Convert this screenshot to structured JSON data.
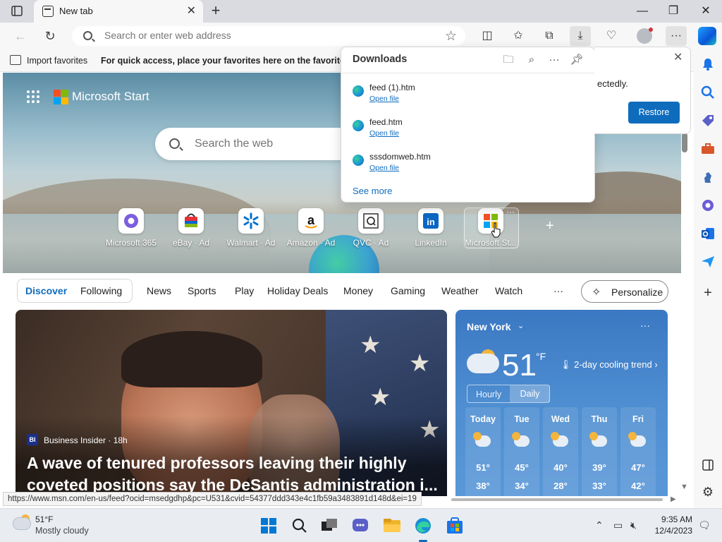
{
  "browser": {
    "tab": {
      "title": "New tab"
    },
    "address": {
      "placeholder": "Search or enter web address"
    },
    "favorites_bar": {
      "import_label": "Import favorites",
      "hint": "For quick access, place your favorites here on the favorites bar."
    },
    "status_url": "https://www.msn.com/en-us/feed?ocid=msedgdhp&pc=U531&cvid=54377ddd343e4c1fb59a3483891d148d&ei=19"
  },
  "downloads": {
    "title": "Downloads",
    "items": [
      {
        "name": "feed (1).htm",
        "action": "Open file"
      },
      {
        "name": "feed.htm",
        "action": "Open file"
      },
      {
        "name": "sssdomweb.htm",
        "action": "Open file"
      }
    ],
    "see_more": "See more"
  },
  "restore_notice": {
    "text_visible": "ectedly.",
    "button": "Restore"
  },
  "new_tab_page": {
    "brand": "Microsoft Start",
    "search_placeholder": "Search the web",
    "tiles": [
      {
        "label": "Microsoft 365",
        "icon": "microsoft-365-icon"
      },
      {
        "label": "eBay · Ad",
        "icon": "ebay-icon"
      },
      {
        "label": "Walmart · Ad",
        "icon": "walmart-icon"
      },
      {
        "label": "Amazon · Ad",
        "icon": "amazon-icon"
      },
      {
        "label": "QVC · Ad",
        "icon": "qvc-icon"
      },
      {
        "label": "LinkedIn",
        "icon": "linkedin-icon"
      },
      {
        "label": "Microsoft St...",
        "icon": "microsoft-store-icon"
      }
    ],
    "feed_tabs": {
      "discover": "Discover",
      "following": "Following",
      "links": [
        "News",
        "Sports",
        "Play",
        "Holiday Deals",
        "Money",
        "Gaming",
        "Weather",
        "Watch"
      ],
      "more": "···",
      "personalize": "Personalize"
    },
    "hero_story": {
      "source_badge": "BI",
      "source": "Business Insider · 18h",
      "headline": "A wave of tenured professors leaving their highly coveted positions say the DeSantis administration i..."
    },
    "weather": {
      "city": "New York",
      "temp": "51",
      "unit": "°F",
      "trend": "2-day cooling trend",
      "toggle": [
        "Hourly",
        "Daily"
      ],
      "days": [
        {
          "name": "Today",
          "hi": "51°",
          "lo": "38°"
        },
        {
          "name": "Tue",
          "hi": "45°",
          "lo": "34°"
        },
        {
          "name": "Wed",
          "hi": "40°",
          "lo": "28°"
        },
        {
          "name": "Thu",
          "hi": "39°",
          "lo": "33°"
        },
        {
          "name": "Fri",
          "hi": "47°",
          "lo": "42°"
        }
      ]
    }
  },
  "taskbar": {
    "weather_temp": "51°F",
    "weather_condition": "Mostly cloudy",
    "time": "9:35 AM",
    "date": "12/4/2023"
  },
  "colors": {
    "accent": "#0f6cbd",
    "weather_card": "#4e8ed1",
    "title_bar": "#d9dbe0"
  }
}
